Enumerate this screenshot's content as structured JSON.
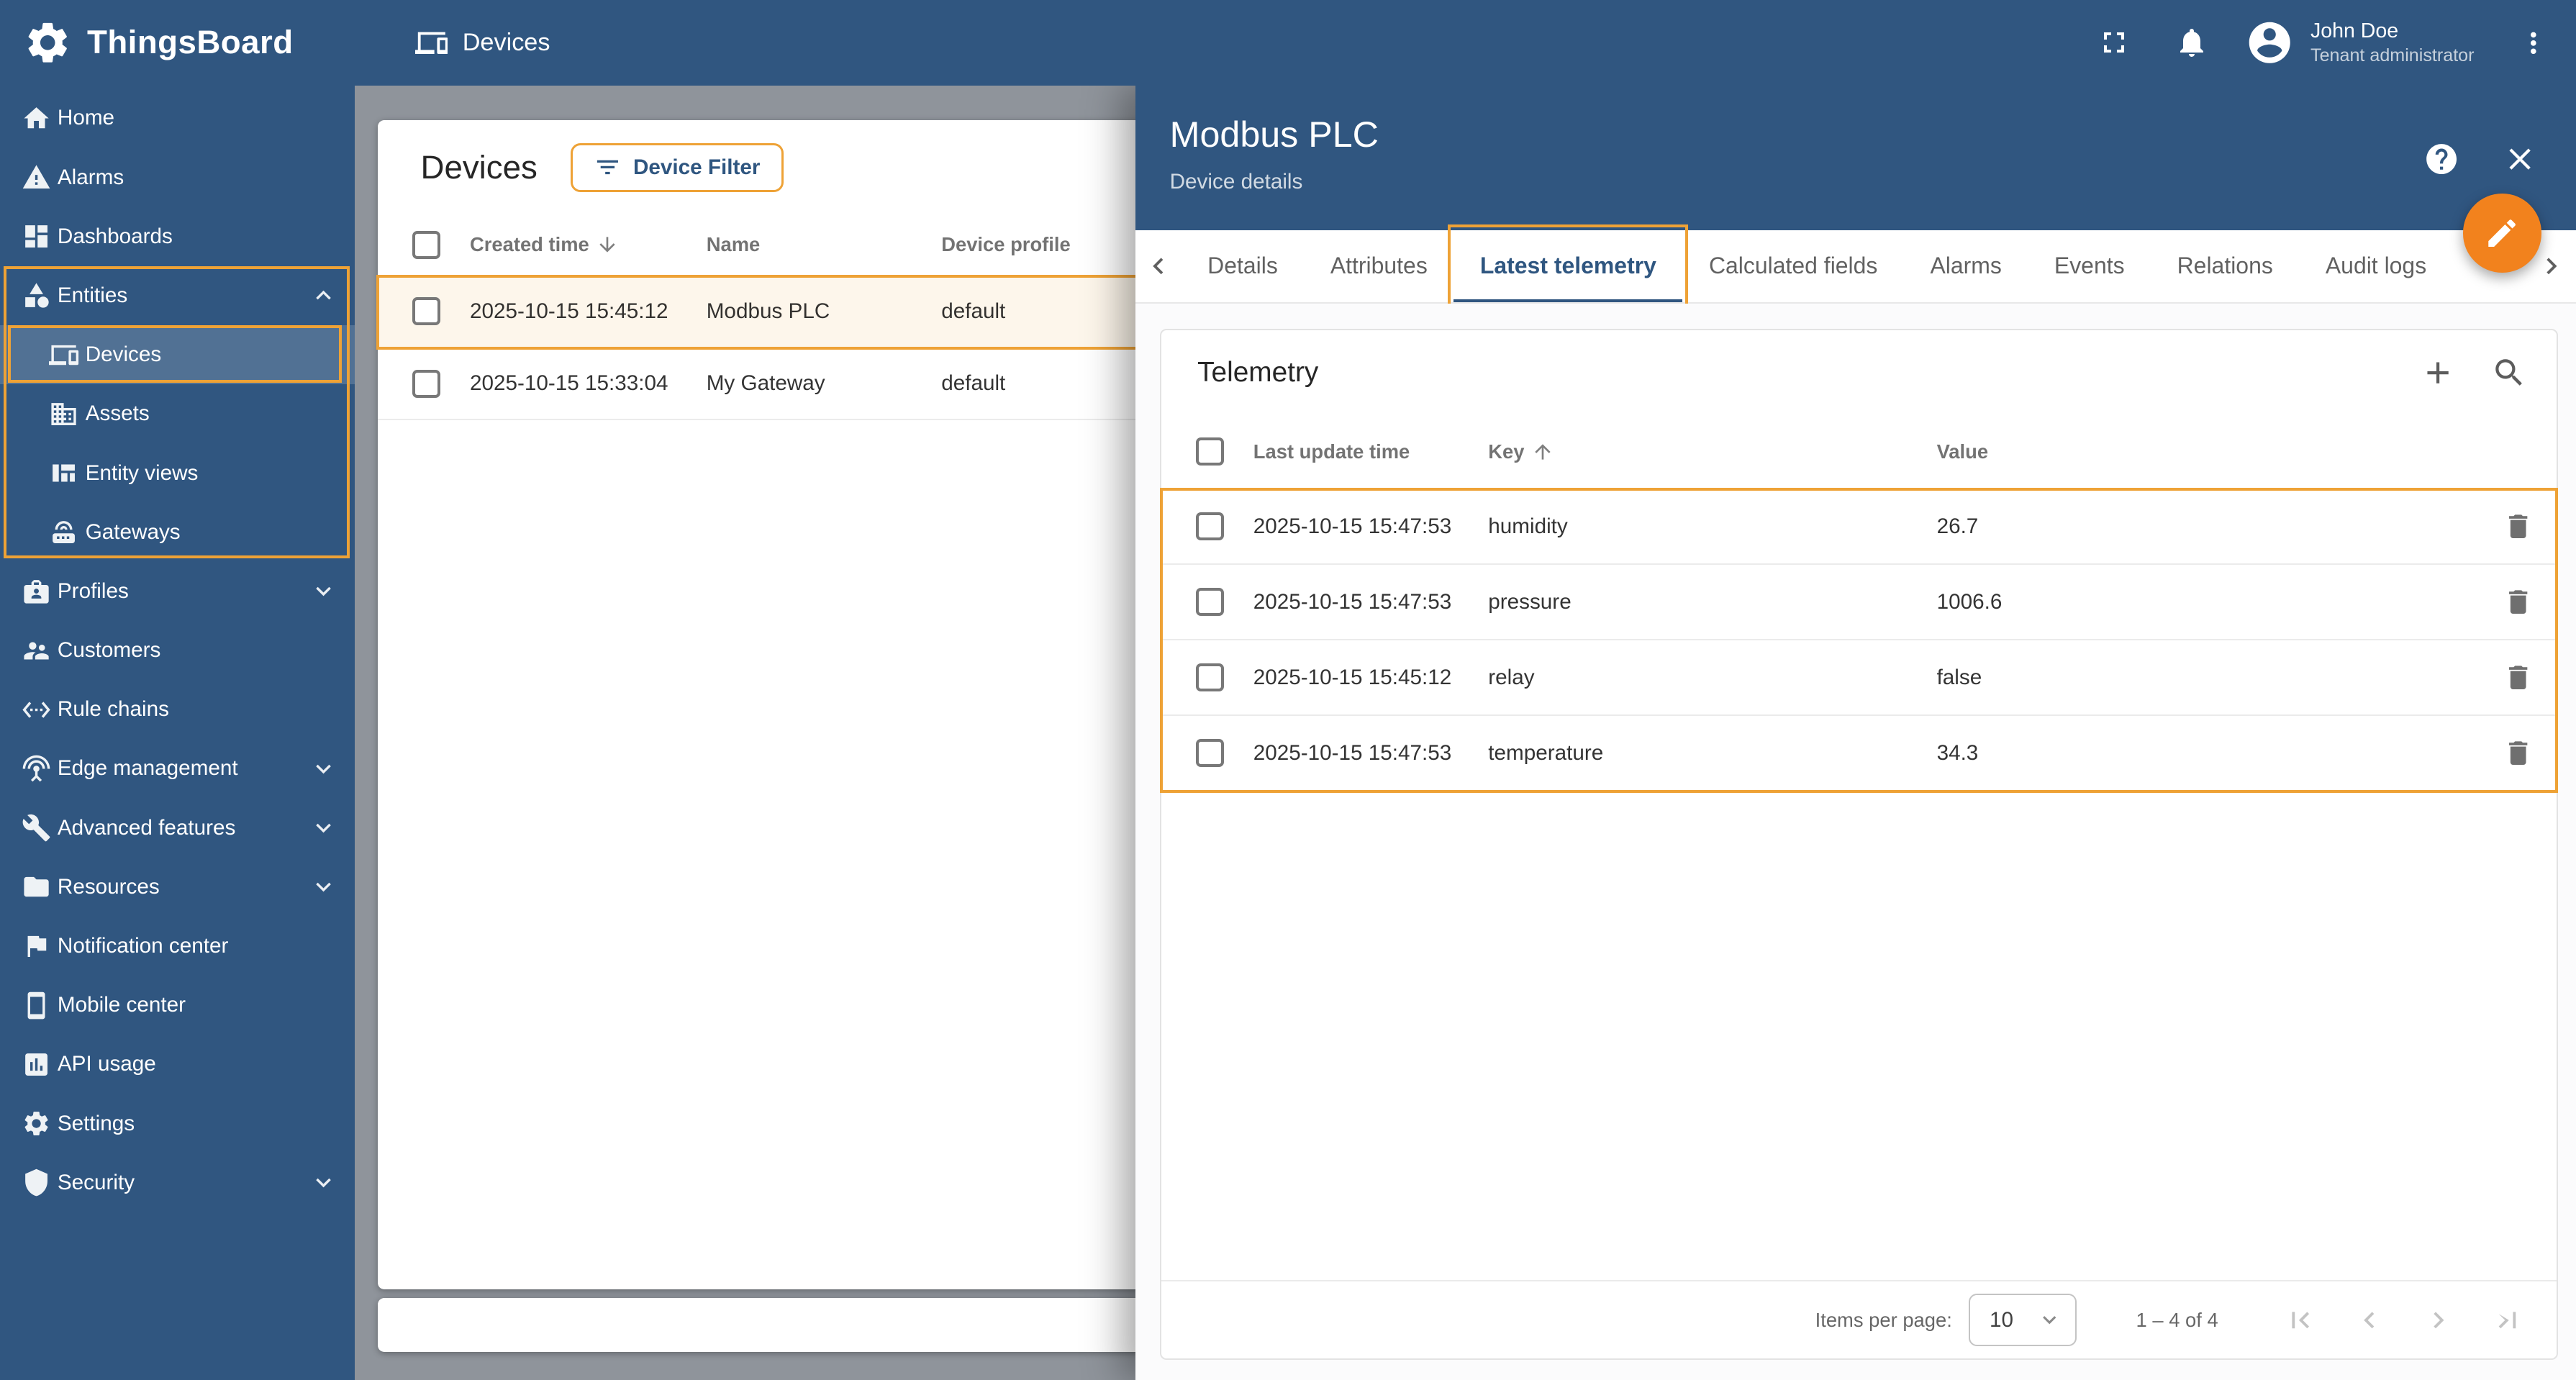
{
  "app": {
    "brand": "ThingsBoard",
    "page_title": "Devices",
    "user": {
      "name": "John Doe",
      "role": "Tenant administrator"
    }
  },
  "colors": {
    "primary_blue": "#305680",
    "annotation_orange": "#eea236",
    "fab_orange": "#f2821d"
  },
  "sidebar": {
    "items": [
      {
        "label": "Home",
        "icon": "home-icon"
      },
      {
        "label": "Alarms",
        "icon": "warning-icon"
      },
      {
        "label": "Dashboards",
        "icon": "dashboard-icon"
      },
      {
        "label": "Entities",
        "icon": "category-icon",
        "expanded": true
      },
      {
        "label": "Devices",
        "icon": "devices-icon",
        "child": true,
        "selected": true
      },
      {
        "label": "Assets",
        "icon": "domain-icon",
        "child": true
      },
      {
        "label": "Entity views",
        "icon": "view-quilt-icon",
        "child": true
      },
      {
        "label": "Gateways",
        "icon": "router-icon",
        "child": true
      },
      {
        "label": "Profiles",
        "icon": "badge-icon",
        "collapsible": true
      },
      {
        "label": "Customers",
        "icon": "people-icon"
      },
      {
        "label": "Rule chains",
        "icon": "ethernet-icon"
      },
      {
        "label": "Edge management",
        "icon": "antenna-icon",
        "collapsible": true
      },
      {
        "label": "Advanced features",
        "icon": "build-icon",
        "collapsible": true
      },
      {
        "label": "Resources",
        "icon": "folder-icon",
        "collapsible": true
      },
      {
        "label": "Notification center",
        "icon": "flag-icon"
      },
      {
        "label": "Mobile center",
        "icon": "smartphone-icon"
      },
      {
        "label": "API usage",
        "icon": "chart-icon"
      },
      {
        "label": "Settings",
        "icon": "settings-icon"
      },
      {
        "label": "Security",
        "icon": "shield-icon",
        "collapsible": true
      }
    ]
  },
  "devices_panel": {
    "title": "Devices",
    "filter_button": "Device Filter",
    "columns": [
      {
        "label": "Created time",
        "sort": "desc"
      },
      {
        "label": "Name"
      },
      {
        "label": "Device profile"
      }
    ],
    "rows": [
      {
        "created": "2025-10-15 15:45:12",
        "name": "Modbus PLC",
        "profile": "default",
        "selected": true
      },
      {
        "created": "2025-10-15 15:33:04",
        "name": "My Gateway",
        "profile": "default",
        "selected": false
      }
    ]
  },
  "details": {
    "title": "Modbus PLC",
    "subtitle": "Device details",
    "tabs": [
      "Details",
      "Attributes",
      "Latest telemetry",
      "Calculated fields",
      "Alarms",
      "Events",
      "Relations",
      "Audit logs"
    ],
    "active_tab": "Latest telemetry"
  },
  "telemetry": {
    "title": "Telemetry",
    "columns": [
      {
        "label": "Last update time"
      },
      {
        "label": "Key",
        "sort": "asc"
      },
      {
        "label": "Value"
      }
    ],
    "rows": [
      {
        "time": "2025-10-15 15:47:53",
        "key": "humidity",
        "value": "26.7"
      },
      {
        "time": "2025-10-15 15:47:53",
        "key": "pressure",
        "value": "1006.6"
      },
      {
        "time": "2025-10-15 15:45:12",
        "key": "relay",
        "value": "false"
      },
      {
        "time": "2025-10-15 15:47:53",
        "key": "temperature",
        "value": "34.3"
      }
    ],
    "pagination": {
      "items_per_page_label": "Items per page:",
      "items_per_page": "10",
      "range": "1 – 4 of 4"
    }
  }
}
